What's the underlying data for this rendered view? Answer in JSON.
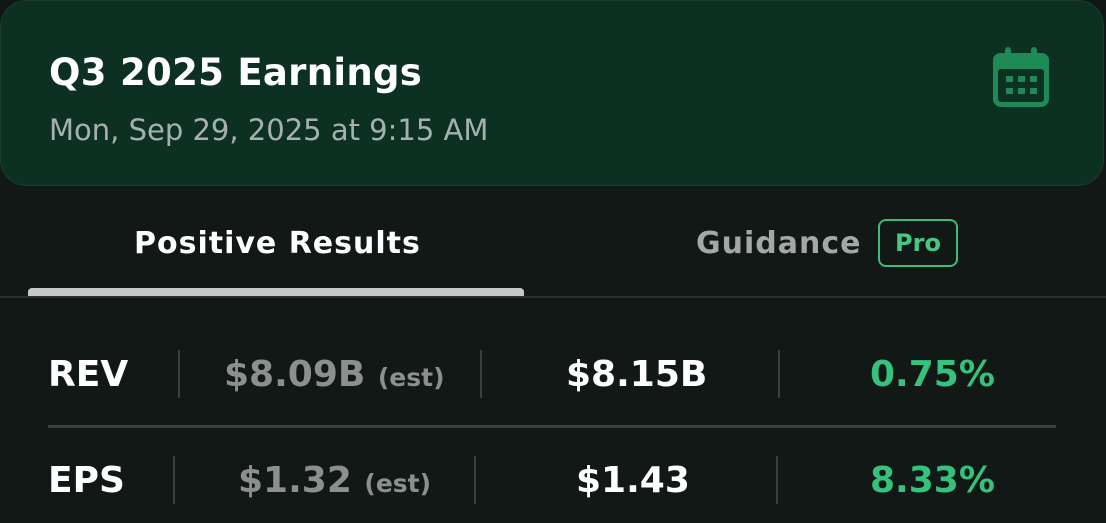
{
  "header": {
    "title": "Q3 2025 Earnings",
    "datetime": "Mon, Sep 29, 2025 at 9:15 AM",
    "icon": "calendar-icon"
  },
  "tabs": [
    {
      "label": "Positive Results",
      "active": true
    },
    {
      "label": "Guidance",
      "active": false,
      "badge": "Pro"
    }
  ],
  "metrics": [
    {
      "label": "REV",
      "estimate": "$8.09B",
      "estimate_suffix": "(est)",
      "actual": "$8.15B",
      "surprise": "0.75%"
    },
    {
      "label": "EPS",
      "estimate": "$1.32",
      "estimate_suffix": "(est)",
      "actual": "$1.43",
      "surprise": "8.33%"
    }
  ],
  "colors": {
    "header_bg": "#0c3123",
    "accent_green": "#35c27c",
    "background": "#111816"
  }
}
